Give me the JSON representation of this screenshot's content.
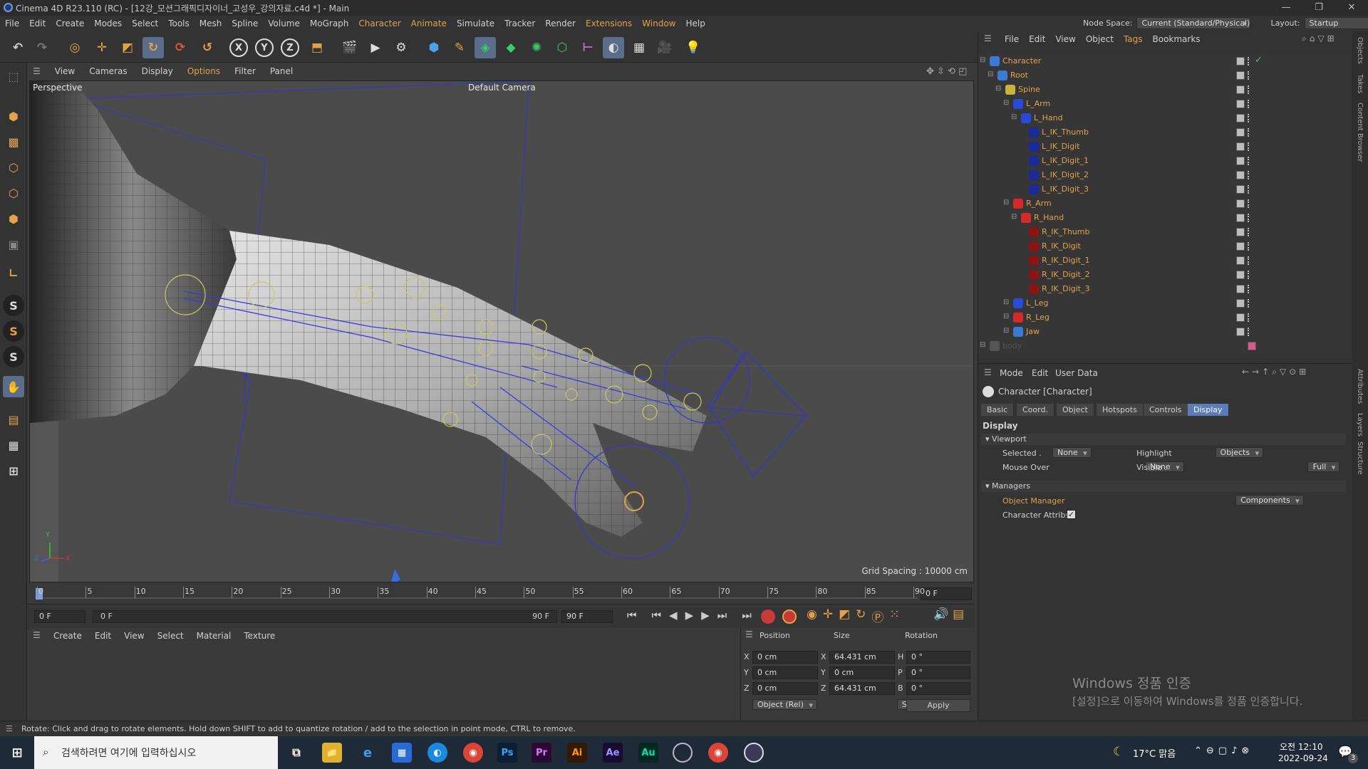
{
  "window": {
    "title": "Cinema 4D R23.110 (RC) - [12강_모션그래픽디자이너_고성우_강의자료.c4d *] - Main",
    "controls": [
      "—",
      "❐",
      "✕"
    ]
  },
  "menubar": {
    "items": [
      "File",
      "Edit",
      "Create",
      "Modes",
      "Select",
      "Tools",
      "Mesh",
      "Spline",
      "Volume",
      "MoGraph",
      "Character",
      "Animate",
      "Simulate",
      "Tracker",
      "Render",
      "Extensions",
      "Window",
      "Help"
    ],
    "node_space_label": "Node Space:",
    "node_space_value": "Current (Standard/Physical)",
    "layout_label": "Layout:",
    "layout_value": "Startup"
  },
  "viewport": {
    "menu": [
      "View",
      "Cameras",
      "Display",
      "Options",
      "Filter",
      "Panel"
    ],
    "label": "Perspective",
    "camera": "Default Camera",
    "grid_spacing": "Grid Spacing : 10000 cm",
    "axis_labels": {
      "y": "Y",
      "z": "Z",
      "x": "X"
    }
  },
  "timeline": {
    "ticks": [
      "0",
      "5",
      "10",
      "15",
      "20",
      "25",
      "30",
      "35",
      "40",
      "45",
      "50",
      "55",
      "60",
      "65",
      "70",
      "75",
      "80",
      "85",
      "90"
    ],
    "current_frame": "0 F",
    "start": "0 F",
    "range_start": "0 F",
    "range_end": "90 F",
    "end": "90 F"
  },
  "material_manager": {
    "menu": [
      "Create",
      "Edit",
      "View",
      "Select",
      "Material",
      "Texture"
    ]
  },
  "coordinates": {
    "headers": [
      "Position",
      "Size",
      "Rotation"
    ],
    "rows": [
      {
        "axis": "X",
        "pos": "0 cm",
        "size_axis": "X",
        "size": "64.431 cm",
        "rot_axis": "H",
        "rot": "0 °"
      },
      {
        "axis": "Y",
        "pos": "0 cm",
        "size_axis": "Y",
        "size": "0 cm",
        "rot_axis": "P",
        "rot": "0 °"
      },
      {
        "axis": "Z",
        "pos": "0 cm",
        "size_axis": "Z",
        "size": "64.431 cm",
        "rot_axis": "B",
        "rot": "0 °"
      }
    ],
    "mode": "Object (Rel)",
    "size_mode": "Size",
    "apply": "Apply"
  },
  "object_manager": {
    "menu": [
      "File",
      "Edit",
      "View",
      "Object",
      "Tags",
      "Bookmarks"
    ],
    "items": [
      {
        "name": "Character",
        "depth": 0,
        "color": "#3b7bd6"
      },
      {
        "name": "Root",
        "depth": 1,
        "color": "#3b7bd6"
      },
      {
        "name": "Spine",
        "depth": 2,
        "color": "#c8b43a"
      },
      {
        "name": "L_Arm",
        "depth": 3,
        "color": "#2a4bd8"
      },
      {
        "name": "L_Hand",
        "depth": 4,
        "color": "#2a4bd8"
      },
      {
        "name": "L_IK_Thumb",
        "depth": 5,
        "color": "#1a2a9a"
      },
      {
        "name": "L_IK_Digit",
        "depth": 5,
        "color": "#1a2a9a"
      },
      {
        "name": "L_IK_Digit_1",
        "depth": 5,
        "color": "#1a2a9a"
      },
      {
        "name": "L_IK_Digit_2",
        "depth": 5,
        "color": "#1a2a9a"
      },
      {
        "name": "L_IK_Digit_3",
        "depth": 5,
        "color": "#1a2a9a"
      },
      {
        "name": "R_Arm",
        "depth": 3,
        "color": "#d62a2a"
      },
      {
        "name": "R_Hand",
        "depth": 4,
        "color": "#d62a2a"
      },
      {
        "name": "R_IK_Thumb",
        "depth": 5,
        "color": "#8a1414"
      },
      {
        "name": "R_IK_Digit",
        "depth": 5,
        "color": "#8a1414"
      },
      {
        "name": "R_IK_Digit_1",
        "depth": 5,
        "color": "#8a1414"
      },
      {
        "name": "R_IK_Digit_2",
        "depth": 5,
        "color": "#8a1414"
      },
      {
        "name": "R_IK_Digit_3",
        "depth": 5,
        "color": "#8a1414"
      },
      {
        "name": "L_Leg",
        "depth": 3,
        "color": "#2a4bd8"
      },
      {
        "name": "R_Leg",
        "depth": 3,
        "color": "#d62a2a"
      },
      {
        "name": "Jaw",
        "depth": 3,
        "color": "#3b7bd6"
      },
      {
        "name": "body",
        "depth": 0,
        "color": "#555555"
      }
    ]
  },
  "attributes": {
    "menu": [
      "Mode",
      "Edit",
      "User Data"
    ],
    "object_title": "Character [Character]",
    "tabs": [
      "Basic",
      "Coord.",
      "Object",
      "Hotspots",
      "Controls",
      "Display"
    ],
    "active_tab": "Display",
    "section": "Display",
    "viewport_group": "Viewport",
    "selected_label": "Selected .",
    "selected_value": "None",
    "highlight_label": "Highlight",
    "highlight_value": "Objects",
    "mouseover_label": "Mouse Over",
    "mouseover_value": "None",
    "visible_label": "Visible .",
    "visible_value": "Full",
    "managers_group": "Managers",
    "objmgr_label": "Object Manager",
    "objmgr_value": "Components",
    "charattr_label": "Character Attribs",
    "charattr_checked": true
  },
  "right_strip": {
    "tabs_top": [
      "Objects",
      "Takes",
      "Content Browser"
    ],
    "tabs_bottom": [
      "Attributes",
      "Layers",
      "Structure"
    ]
  },
  "status": {
    "text": "Rotate: Click and drag to rotate elements. Hold down SHIFT to add to quantize rotation / add to the selection in point mode, CTRL to remove."
  },
  "watermark": {
    "line1": "Windows 정품 인증",
    "line2": "[설정]으로 이동하여 Windows를 정품 인증합니다."
  },
  "taskbar": {
    "search_placeholder": "검색하려면 여기에 입력하십시오",
    "apps": [
      "Ps",
      "Pr",
      "Ai",
      "Ae",
      "Au"
    ],
    "weather": "17°C 맑음",
    "time": "오전 12:10",
    "date": "2022-09-24",
    "notifications": "3"
  }
}
